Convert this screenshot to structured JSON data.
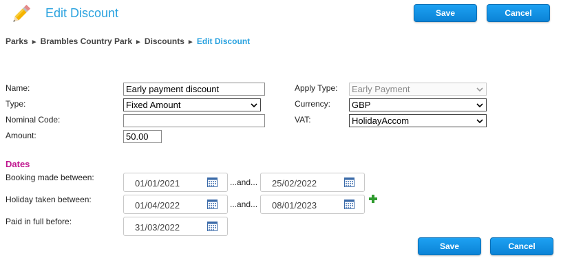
{
  "header": {
    "title": "Edit Discount",
    "save_label": "Save",
    "cancel_label": "Cancel"
  },
  "breadcrumb": {
    "items": [
      "Parks",
      "Brambles Country Park",
      "Discounts"
    ],
    "current": "Edit Discount"
  },
  "form": {
    "name_label": "Name:",
    "name_value": "Early payment discount",
    "type_label": "Type:",
    "type_value": "Fixed Amount",
    "nominal_label": "Nominal Code:",
    "nominal_value": "",
    "amount_label": "Amount:",
    "amount_value": "50.00",
    "apply_type_label": "Apply Type:",
    "apply_type_value": "Early Payment",
    "currency_label": "Currency:",
    "currency_value": "GBP",
    "vat_label": "VAT:",
    "vat_value": "HolidayAccom"
  },
  "dates": {
    "title": "Dates",
    "and_label": "...and...",
    "booking_label": "Booking made between:",
    "booking_from": "01/01/2021",
    "booking_to": "25/02/2022",
    "holiday_label": "Holiday taken between:",
    "holiday_from": "01/04/2022",
    "holiday_to": "08/01/2023",
    "paid_label": "Paid in full before:",
    "paid_before": "31/03/2022"
  },
  "footer": {
    "save_label": "Save",
    "cancel_label": "Cancel"
  },
  "colors": {
    "accent": "#2aa2df",
    "button": "#0b83d6",
    "section": "#c0168f",
    "add": "#2e9b2e"
  },
  "icons": {
    "page": "pencil-icon",
    "date": "calendar-icon",
    "add": "plus-icon",
    "select": "chevron-down-icon"
  }
}
